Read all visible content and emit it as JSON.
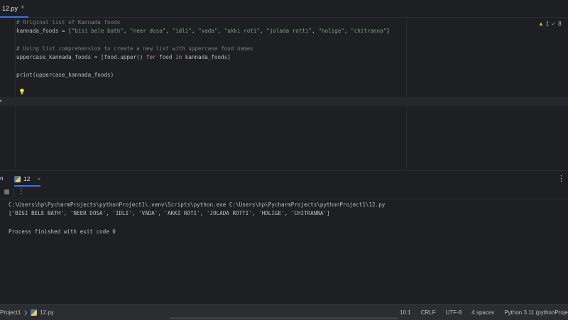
{
  "editor": {
    "tab": {
      "label": "12.py"
    },
    "inspections": {
      "warnings": "1",
      "ok": "8"
    },
    "code": {
      "line1_comment": "# Original list of Kannada foods",
      "line2_var": "kannada_foods = [",
      "line2_items": [
        "\"bisi bele bath\"",
        "\"neer dosa\"",
        "\"idli\"",
        "\"vada\"",
        "\"akki roti\"",
        "\"jolada rotti\"",
        "\"holige\"",
        "\"chitranna\""
      ],
      "line4_comment": "# Using list comprehension to create a new list with uppercase food names",
      "line5_a": "uppercase_kannada_foods = [food.upper() ",
      "line5_for": "for",
      "line5_b": " food ",
      "line5_in": "in",
      "line5_c": " kannada_foods]",
      "line7": "print(uppercase_kannada_foods)"
    }
  },
  "run": {
    "label": "n",
    "tab_label": "12",
    "console": {
      "command": "C:\\Users\\hp\\PycharmProjects\\pythonProject1\\.venv\\Scripts\\python.exe C:\\Users\\hp\\PycharmProjects\\pythonProject1\\12.py",
      "output": "['BISI BELE BATH', 'NEER DOSA', 'IDLI', 'VADA', 'AKKI ROTI', 'JOLADA ROTTI', 'HOLIGE', 'CHITRANNA']",
      "exit": "Process finished with exit code 0"
    }
  },
  "statusbar": {
    "project": "Project1",
    "file": "12.py",
    "position": "10:1",
    "line_sep": "CRLF",
    "encoding": "UTF-8",
    "indent": "4 spaces",
    "interpreter": "Python 3.11 (pythonProje"
  }
}
